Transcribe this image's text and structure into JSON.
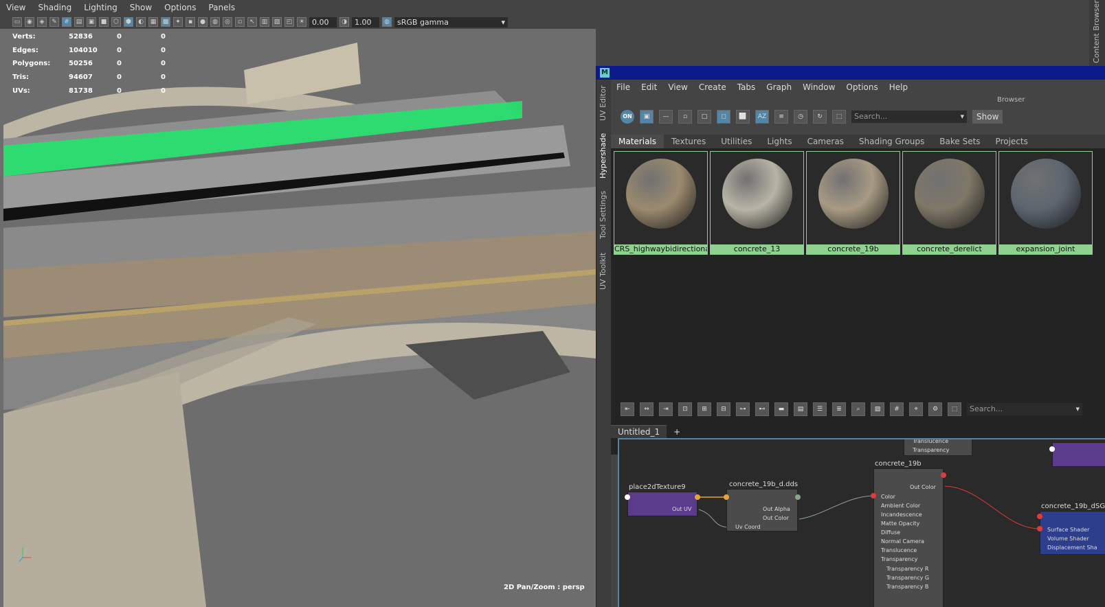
{
  "viewport": {
    "menu": [
      "View",
      "Shading",
      "Lighting",
      "Show",
      "Options",
      "Panels"
    ],
    "toolbar": {
      "field_a": "0.00",
      "field_b": "1.00",
      "color_space": "sRGB gamma"
    },
    "hud": [
      {
        "label": "Verts:",
        "v1": "52836",
        "v2": "0",
        "v3": "0"
      },
      {
        "label": "Edges:",
        "v1": "104010",
        "v2": "0",
        "v3": "0"
      },
      {
        "label": "Polygons:",
        "v1": "50256",
        "v2": "0",
        "v3": "0"
      },
      {
        "label": "Tris:",
        "v1": "94607",
        "v2": "0",
        "v3": "0"
      },
      {
        "label": "UVs:",
        "v1": "81738",
        "v2": "0",
        "v3": "0"
      }
    ],
    "status": "2D Pan/Zoom : persp",
    "side_panel_label": "Content Browser"
  },
  "hypershade": {
    "side_tabs": [
      "UV Editor",
      "Hypershade",
      "Tool Settings",
      "UV Toolkit"
    ],
    "menu": [
      "File",
      "Edit",
      "View",
      "Create",
      "Tabs",
      "Graph",
      "Window",
      "Options",
      "Help"
    ],
    "browser_label": "Browser",
    "search_placeholder": "Search...",
    "show_label": "Show",
    "browser_tabs": [
      "Materials",
      "Textures",
      "Utilities",
      "Lights",
      "Cameras",
      "Shading Groups",
      "Bake Sets",
      "Projects"
    ],
    "materials": [
      {
        "name": "CRS_highwaybidirectional",
        "color": "#9b8a6e"
      },
      {
        "name": "concrete_13",
        "color": "#b8b4a6"
      },
      {
        "name": "concrete_19b",
        "color": "#a89a84"
      },
      {
        "name": "concrete_derelict",
        "color": "#7f7868"
      },
      {
        "name": "expansion_joint",
        "color": "#5d6670"
      }
    ],
    "graph_search_placeholder": "Search...",
    "graph_tabs": [
      "Untitled_1",
      "+"
    ],
    "nodes": {
      "place2d": {
        "title": "place2dTexture9",
        "port": "Out UV"
      },
      "file": {
        "title": "concrete_19b_d.dds",
        "ports": [
          "Out Alpha",
          "Out Color"
        ],
        "in_port": "Uv Coord"
      },
      "shader": {
        "title": "concrete_19b",
        "out_port": "Out Color",
        "inputs": [
          "Color",
          "Ambient Color",
          "Incandescence",
          "Matte Opacity",
          "Diffuse",
          "Normal Camera",
          "Translucence",
          "Transparency",
          "Transparency R",
          "Transparency G",
          "Transparency B"
        ]
      },
      "top_partial": {
        "ports": [
          "Translucence",
          "Transparency"
        ]
      },
      "sg": {
        "title": "concrete_19b_dSG",
        "inputs": [
          "Surface Shader",
          "Volume Shader",
          "Displacement Sha"
        ]
      }
    }
  }
}
